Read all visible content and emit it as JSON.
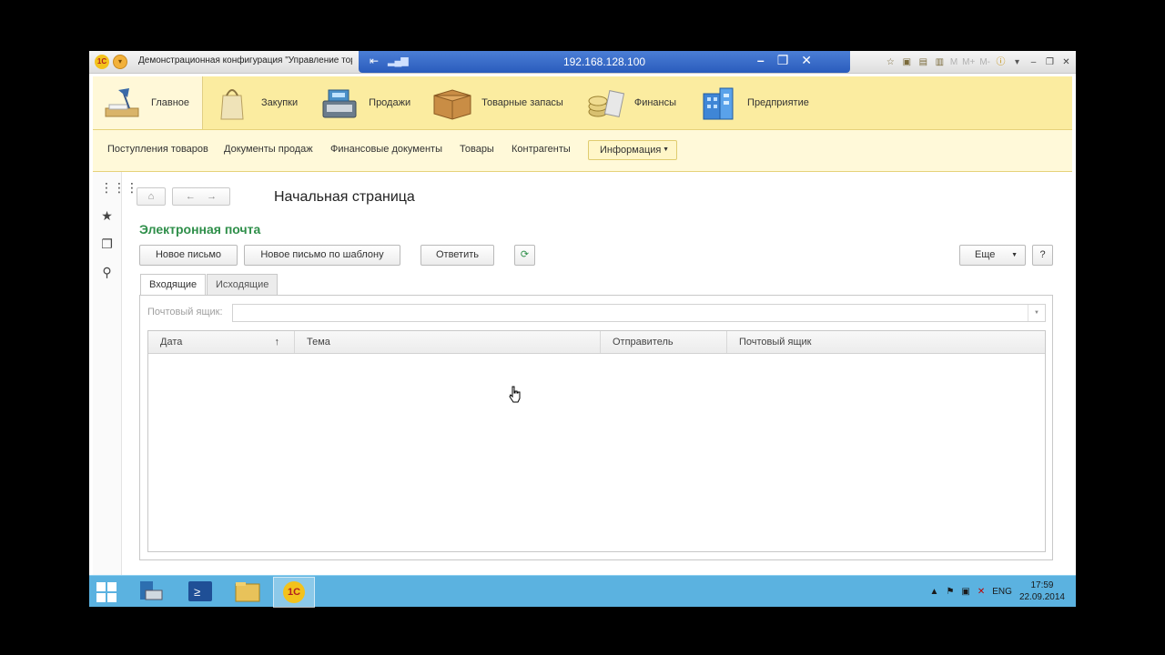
{
  "window": {
    "title": "Демонстрационная конфигурация \"Управление торговлей\"",
    "logo": "1С",
    "top_m_icons": [
      "M",
      "M+",
      "M-"
    ]
  },
  "rdp": {
    "host": "192.168.128.100"
  },
  "sections": [
    {
      "label": "Главное",
      "icon": "desk-lamp-icon"
    },
    {
      "label": "Закупки",
      "icon": "shopping-bag-icon"
    },
    {
      "label": "Продажи",
      "icon": "cash-register-icon"
    },
    {
      "label": "Товарные запасы",
      "icon": "box-icon"
    },
    {
      "label": "Финансы",
      "icon": "coins-icon"
    },
    {
      "label": "Предприятие",
      "icon": "building-icon"
    }
  ],
  "commands": {
    "items": [
      "Поступления товаров",
      "Документы продаж",
      "Финансовые документы",
      "Товары",
      "Контрагенты"
    ],
    "info_label": "Информация"
  },
  "page": {
    "title": "Начальная страница"
  },
  "form": {
    "title": "Электронная почта",
    "buttons": {
      "new_letter": "Новое письмо",
      "new_from_template": "Новое письмо по шаблону",
      "reply": "Ответить",
      "more": "Еще",
      "help": "?"
    },
    "tabs": {
      "incoming": "Входящие",
      "outgoing": "Исходящие"
    },
    "mailbox_label": "Почтовый ящик:",
    "mailbox_value": "",
    "columns": [
      "Дата",
      "Тема",
      "Отправитель",
      "Почтовый ящик"
    ],
    "sort_indicator": "↑"
  },
  "taskbar": {
    "lang": "ENG",
    "time": "17:59",
    "date": "22.09.2014",
    "active_app": "1С"
  },
  "colors": {
    "sections_bg": "#fbeca0",
    "commands_bg": "#fff9d9",
    "form_title": "#2f8f4a",
    "taskbar": "#5bb2e0",
    "rdp_bar": "#2a5cbc"
  }
}
